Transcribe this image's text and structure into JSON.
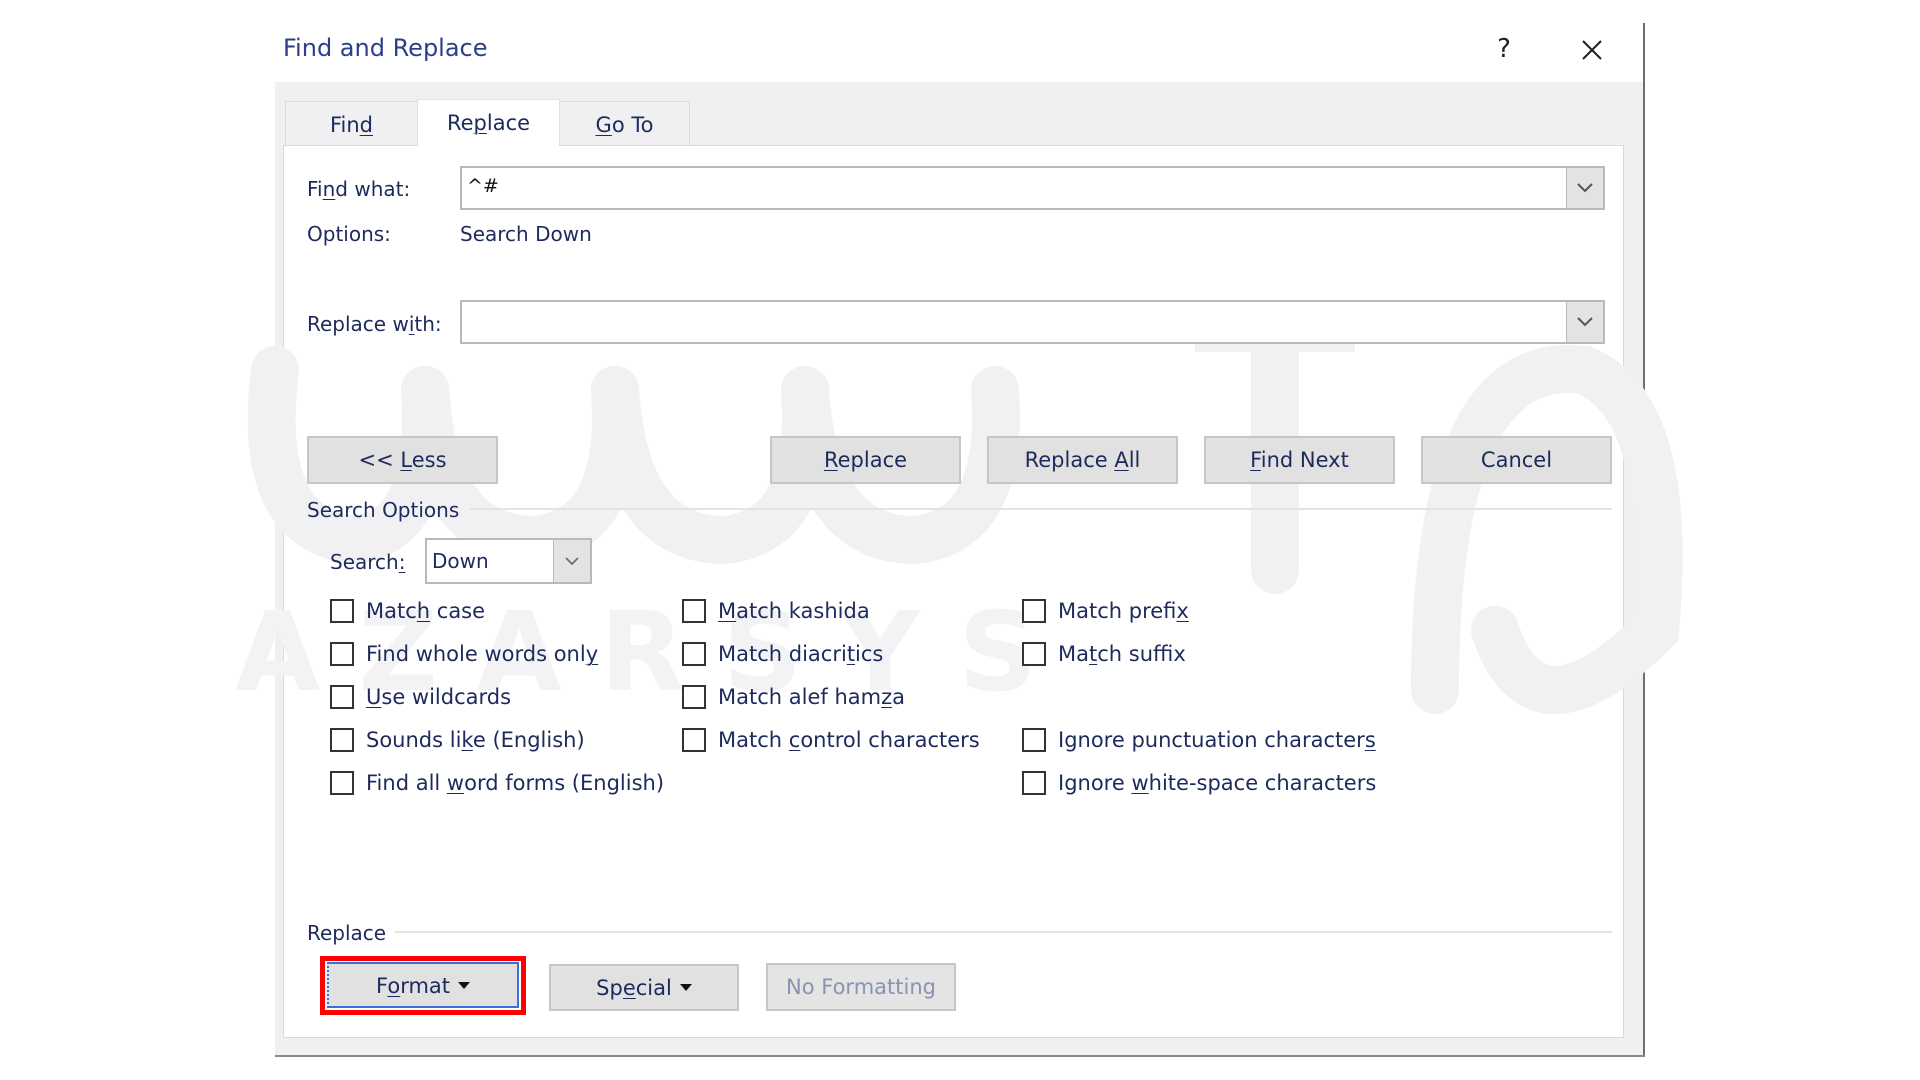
{
  "dialog": {
    "title": "Find and Replace",
    "help_label": "?",
    "close_icon": "close-icon"
  },
  "tabs": [
    {
      "label_pre": "Fin",
      "accel": "d",
      "label_post": "",
      "active": false
    },
    {
      "label_pre": "Re",
      "accel": "p",
      "label_post": "lace",
      "active": true
    },
    {
      "label_pre": "",
      "accel": "G",
      "label_post": "o To",
      "active": false
    }
  ],
  "find": {
    "label_pre": "Fi",
    "label_accel": "n",
    "label_post": "d what:",
    "value": "^#",
    "options_label": "Options:",
    "options_value": "Search Down"
  },
  "replace_with": {
    "label_pre": "Replace w",
    "label_accel": "i",
    "label_post": "th:",
    "value": ""
  },
  "buttons": {
    "less": {
      "pre": "<< ",
      "accel": "L",
      "post": "ess"
    },
    "replace": {
      "pre": "",
      "accel": "R",
      "post": "eplace"
    },
    "replace_all": {
      "pre": "Replace ",
      "accel": "A",
      "post": "ll"
    },
    "find_next": {
      "pre": "",
      "accel": "F",
      "post": "ind Next"
    },
    "cancel": {
      "pre": "Cancel",
      "accel": "",
      "post": ""
    }
  },
  "search_options": {
    "heading": "Search Options",
    "search_label_pre": "Search",
    "search_label_accel": ":",
    "search_value": "Down",
    "checkboxes": [
      {
        "pre": "Matc",
        "accel": "h",
        "post": " case",
        "checked": false
      },
      {
        "pre": "Find whole words onl",
        "accel": "y",
        "post": "",
        "checked": false
      },
      {
        "pre": "",
        "accel": "U",
        "post": "se wildcards",
        "checked": false
      },
      {
        "pre": "Sounds li",
        "accel": "k",
        "post": "e (English)",
        "checked": false
      },
      {
        "pre": "Find all ",
        "accel": "w",
        "post": "ord forms (English)",
        "checked": false
      },
      {
        "pre": "",
        "accel": "M",
        "post": "atch kashida",
        "checked": false
      },
      {
        "pre": "Match diacri",
        "accel": "t",
        "post": "ics",
        "checked": false
      },
      {
        "pre": "Match alef ham",
        "accel": "z",
        "post": "a",
        "checked": false
      },
      {
        "pre": "Match ",
        "accel": "c",
        "post": "ontrol characters",
        "checked": false
      },
      {
        "pre": "Match prefi",
        "accel": "x",
        "post": "",
        "checked": false
      },
      {
        "pre": "Ma",
        "accel": "t",
        "post": "ch suffix",
        "checked": false
      },
      {
        "pre": "Ignore punctuation character",
        "accel": "s",
        "post": "",
        "checked": false
      },
      {
        "pre": "Ignore ",
        "accel": "w",
        "post": "hite-space characters",
        "checked": false
      }
    ]
  },
  "replace_section": {
    "heading": "Replace",
    "format": {
      "pre": "F",
      "accel": "o",
      "post": "rmat",
      "highlighted": true
    },
    "special": {
      "pre": "Sp",
      "accel": "e",
      "post": "cial"
    },
    "no_formatting": {
      "label": "No Formatting",
      "disabled": true
    }
  },
  "watermark": {
    "latin": "A Z A R   S Y S",
    "arabic": "آذرسیس"
  },
  "colors": {
    "text": "#1d2a5c",
    "title": "#2b3f8c",
    "highlight": "#ff0000"
  }
}
